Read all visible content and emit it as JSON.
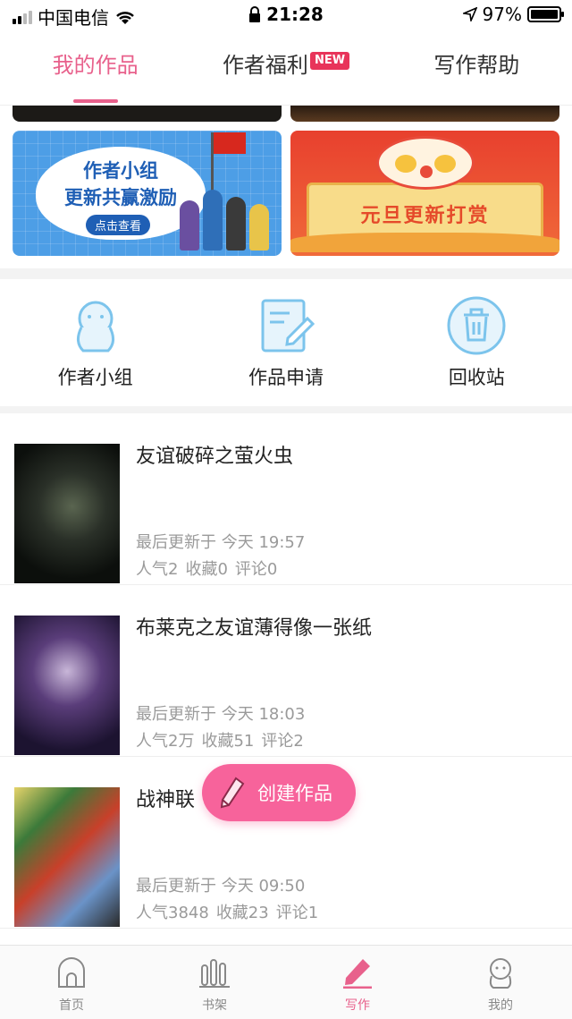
{
  "status_bar": {
    "carrier": "中国电信",
    "time": "21:28",
    "battery": "97%"
  },
  "top_tabs": [
    {
      "label": "我的作品",
      "active": true
    },
    {
      "label": "作者福利",
      "badge": "NEW"
    },
    {
      "label": "写作帮助"
    }
  ],
  "banners": {
    "left": {
      "title_line1": "作者小组",
      "title_line2": "更新共赢激励",
      "button": "点击查看"
    },
    "right": {
      "title": "元旦更新打赏"
    }
  },
  "shortcuts": [
    {
      "label": "作者小组",
      "icon": "author-group-icon"
    },
    {
      "label": "作品申请",
      "icon": "edit-document-icon"
    },
    {
      "label": "回收站",
      "icon": "trash-icon"
    }
  ],
  "works": [
    {
      "title": "友谊破碎之萤火虫",
      "updated": "最后更新于 今天 19:57",
      "popularity": "人气2",
      "favorites": "收藏0",
      "comments": "评论0"
    },
    {
      "title": "布莱克之友谊薄得像一张纸",
      "updated": "最后更新于 今天 18:03",
      "popularity": "人气2万",
      "favorites": "收藏51",
      "comments": "评论2"
    },
    {
      "title": "战神联",
      "updated": "最后更新于 今天 09:50",
      "popularity": "人气3848",
      "favorites": "收藏23",
      "comments": "评论1"
    }
  ],
  "fab": {
    "label": "创建作品"
  },
  "bottom_nav": [
    {
      "label": "首页",
      "icon": "home-icon"
    },
    {
      "label": "书架",
      "icon": "bookshelf-icon"
    },
    {
      "label": "写作",
      "icon": "pen-icon",
      "active": true
    },
    {
      "label": "我的",
      "icon": "profile-icon"
    }
  ],
  "colors": {
    "accent": "#e8618c",
    "fab": "#f7639b",
    "icon_blue": "#7cc4ec"
  }
}
